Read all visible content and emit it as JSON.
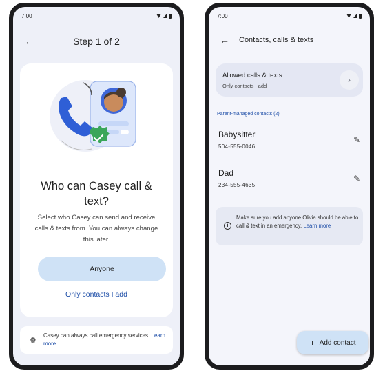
{
  "left_screen": {
    "status": {
      "time": "7:00"
    },
    "header": {
      "title": "Step 1 of 2"
    },
    "card": {
      "heading": "Who can Casey call & text?",
      "description": "Select who Casey can send and receive calls & texts from. You can always change this later.",
      "primary_button": "Anyone",
      "secondary_link": "Only contacts I add"
    },
    "footer": {
      "text": "Casey can always call emergency services. ",
      "link": "Learn more"
    }
  },
  "right_screen": {
    "status": {
      "time": "7:00"
    },
    "header": {
      "title": "Contacts, calls & texts"
    },
    "allowed": {
      "title": "Allowed calls & texts",
      "subtitle": "Only contacts I add"
    },
    "section_label": "Parent-managed contacts (2)",
    "contacts": [
      {
        "name": "Babysitter",
        "phone": "504-555-0046"
      },
      {
        "name": "Dad",
        "phone": "234-555-4635"
      }
    ],
    "info": {
      "text": "Make sure you add anyone Olivia should be able to call & text in an emergency. ",
      "link": "Learn more"
    },
    "fab_label": "Add contact"
  },
  "icons": {
    "back": "arrow-left-icon",
    "chevron": "chevron-right-icon",
    "edit": "pencil-icon",
    "settings": "gear-icon",
    "info": "info-icon",
    "add": "plus-icon"
  },
  "colors": {
    "accent": "#cfe2f6",
    "link": "#1f4fa8",
    "phone_blue": "#2f5fd6",
    "check_green": "#3aa65a"
  }
}
